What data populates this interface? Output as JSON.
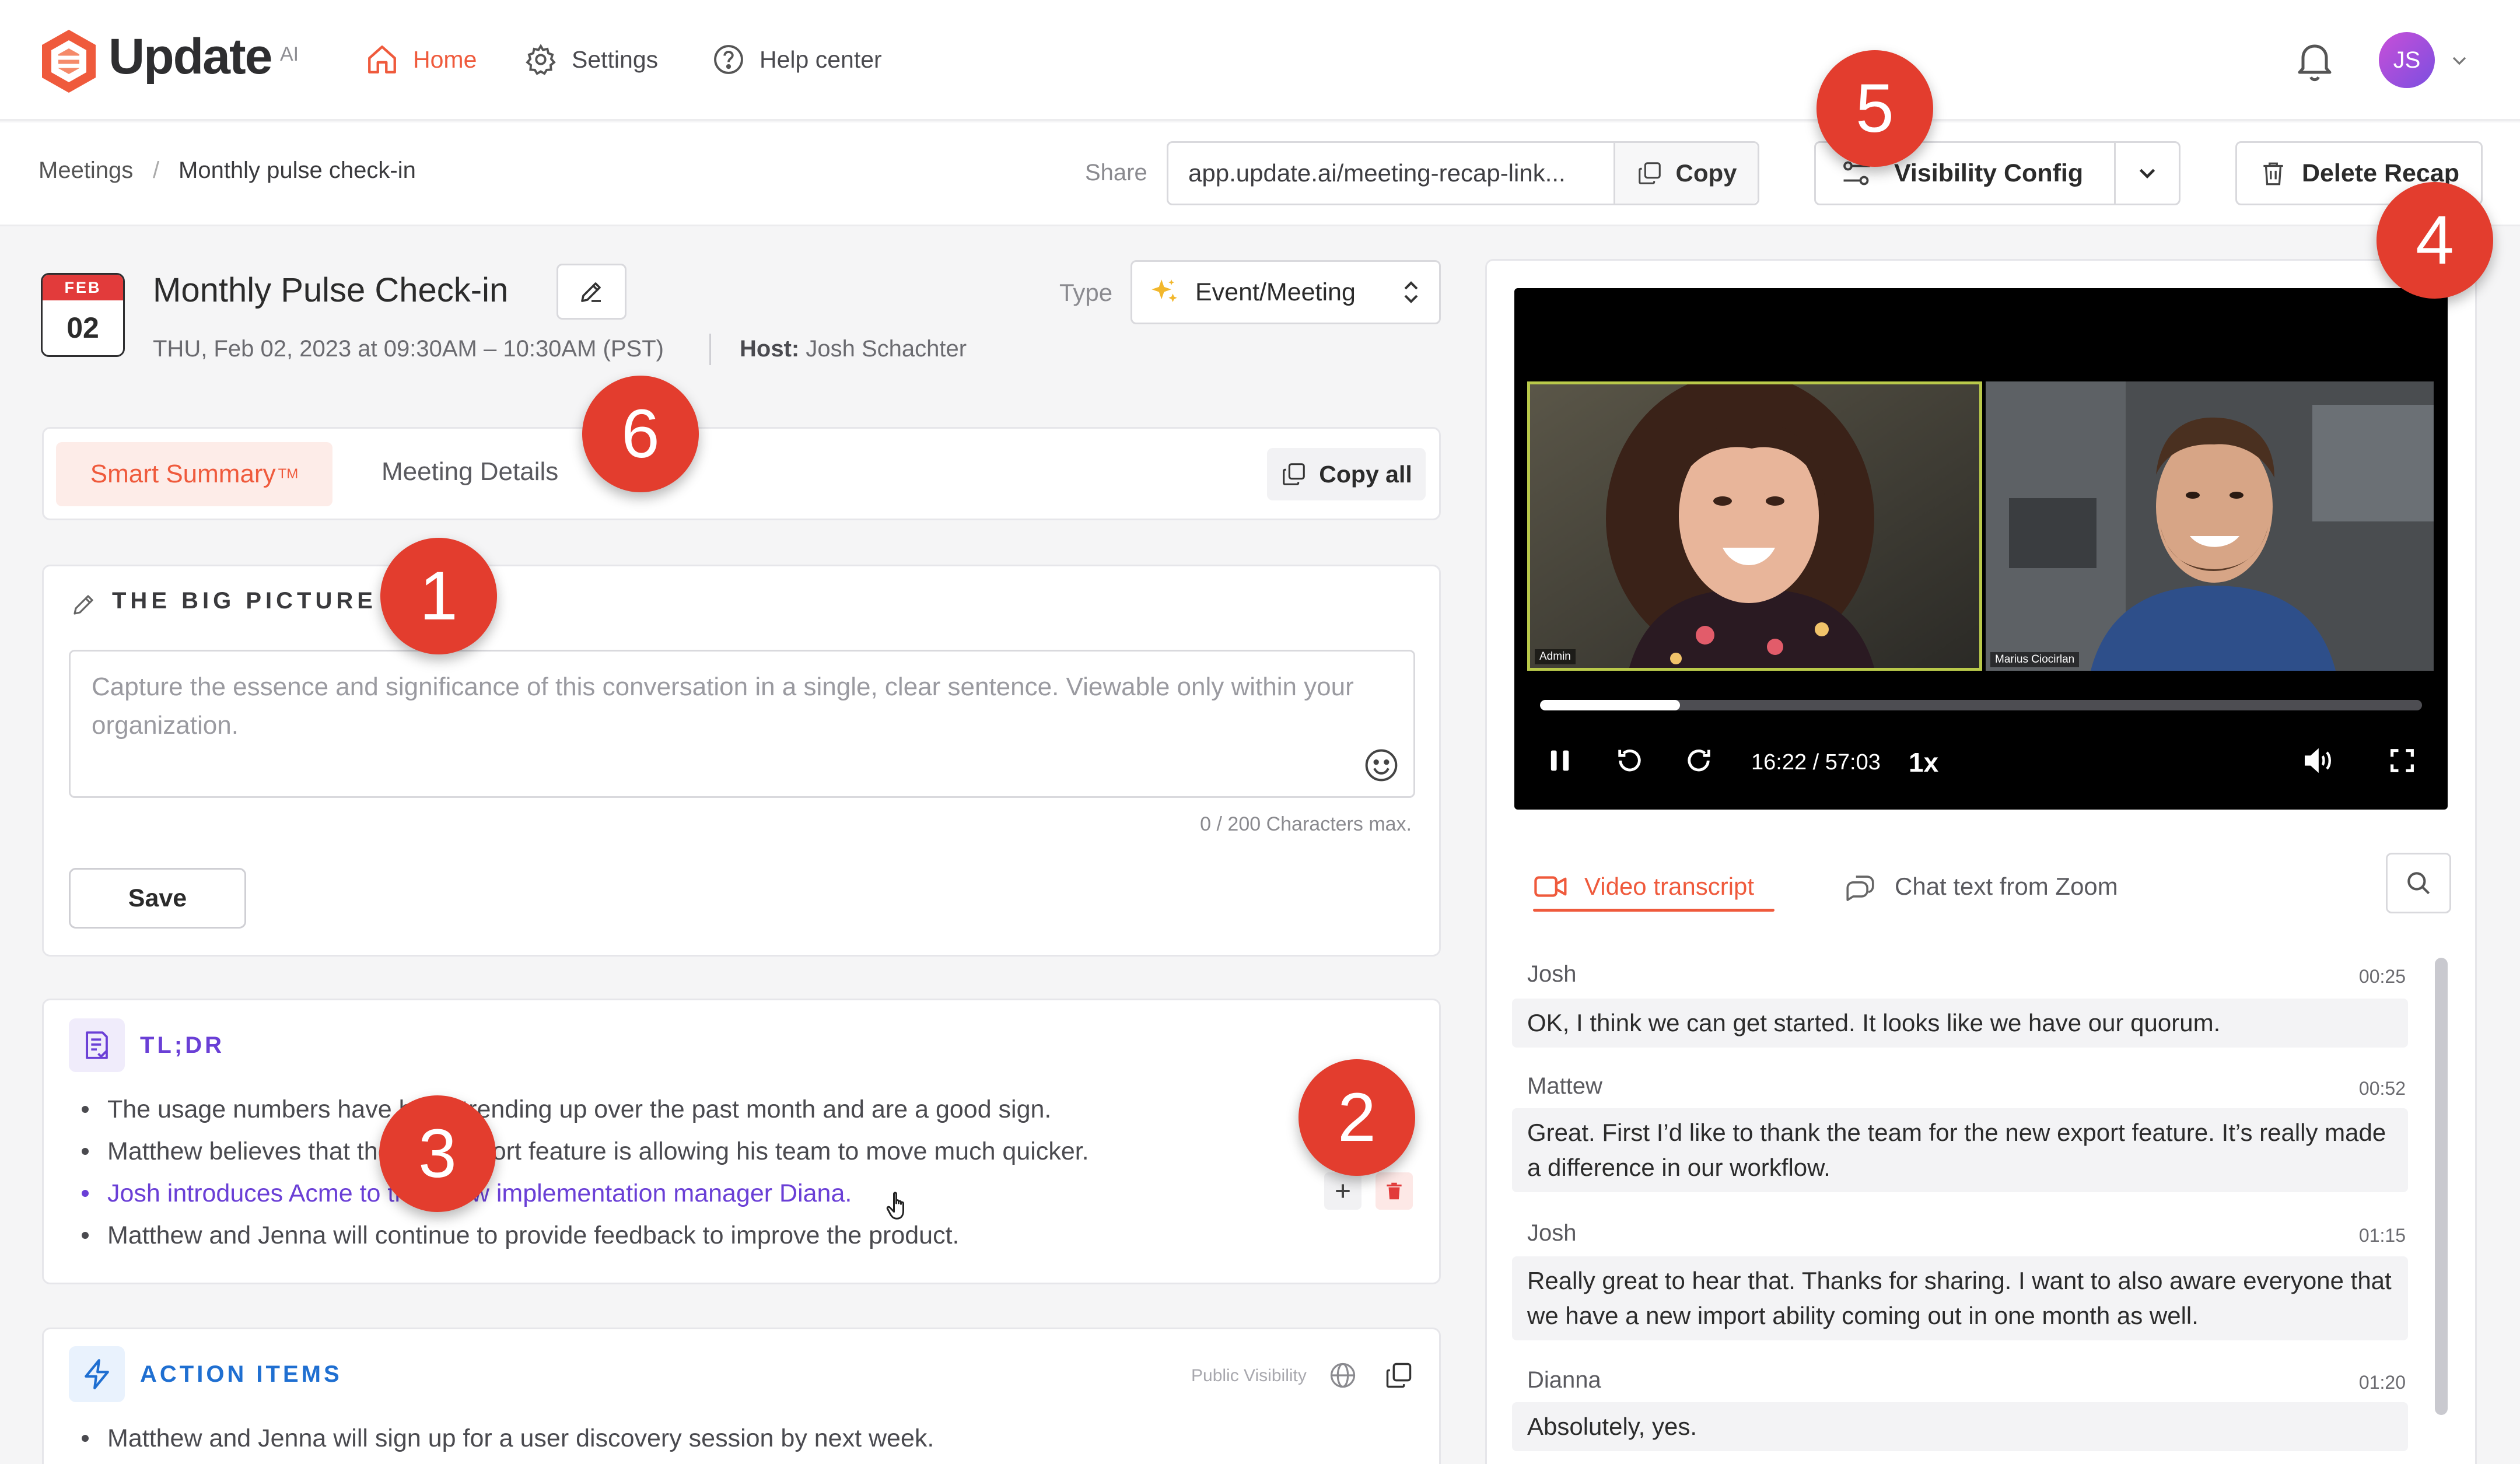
{
  "app": {
    "logo_text": "Update",
    "logo_suffix": "AI"
  },
  "nav": {
    "home": "Home",
    "settings": "Settings",
    "help": "Help center",
    "avatar_initials": "JS"
  },
  "breadcrumb": {
    "root": "Meetings",
    "separator": "/",
    "current": "Monthly pulse check-in"
  },
  "share": {
    "label": "Share",
    "url": "app.update.ai/meeting-recap-link...",
    "copy_label": "Copy"
  },
  "visibility": {
    "label": "Visibility Config"
  },
  "delete": {
    "label": "Delete Recap"
  },
  "meeting": {
    "month": "FEB",
    "day": "02",
    "title": "Monthly Pulse Check-in",
    "datetime": "THU, Feb 02, 2023 at 09:30AM – 10:30AM (PST)",
    "host_label": "Host:",
    "host_name": "Josh Schachter",
    "type_label": "Type",
    "type_value": "Event/Meeting"
  },
  "tabs": {
    "smart_summary": "Smart Summary",
    "smart_summary_tm": "TM",
    "meeting_details": "Meeting Details",
    "copy_all": "Copy all"
  },
  "big_picture": {
    "title": "THE BIG PICTURE",
    "placeholder": "Capture the essence and significance of this conversation in a single, clear sentence. Viewable only within your organization.",
    "char_count": "0 / 200 Characters max.",
    "save_label": "Save"
  },
  "tldr": {
    "title": "TL;DR",
    "items": [
      "The usage numbers have been trending up over the past month and are a good sign.",
      "Matthew believes that the new export feature is allowing his team to move much quicker.",
      "Josh introduces Acme to their new implementation manager Diana.",
      "Matthew and Jenna will continue to provide feedback to improve the product."
    ]
  },
  "action_items": {
    "title": "ACTION ITEMS",
    "visibility": "Public Visibility",
    "items": [
      "Matthew and Jenna will sign up for a user discovery session by next week."
    ]
  },
  "video": {
    "participant_1": "Admin",
    "participant_2": "Marius Ciocirlan",
    "time": "16:22 / 57:03",
    "rate": "1x",
    "progress": 0.159
  },
  "transcript": {
    "tab_video": "Video transcript",
    "tab_chat": "Chat text from Zoom",
    "messages": [
      {
        "name": "Josh",
        "time": "00:25",
        "text": "OK, I think we can get started. It looks like we have our quorum."
      },
      {
        "name": "Mattew",
        "time": "00:52",
        "text": "Great. First I’d like to thank the team for the new export feature. It’s really made a difference in our workflow."
      },
      {
        "name": "Josh",
        "time": "01:15",
        "text": "Really great to hear that. Thanks for sharing. I want to also aware everyone that we have a new import ability coming out in one month as well."
      },
      {
        "name": "Dianna",
        "time": "01:20",
        "text": "Absolutely, yes."
      }
    ]
  },
  "callouts": {
    "c1": "1",
    "c2": "2",
    "c3": "3",
    "c4": "4",
    "c5": "5",
    "c6": "6"
  },
  "colors": {
    "accent": "#ef5a3c",
    "purple": "#6a3fd6",
    "blue": "#1f6fd1",
    "callout": "#e33d2e"
  }
}
